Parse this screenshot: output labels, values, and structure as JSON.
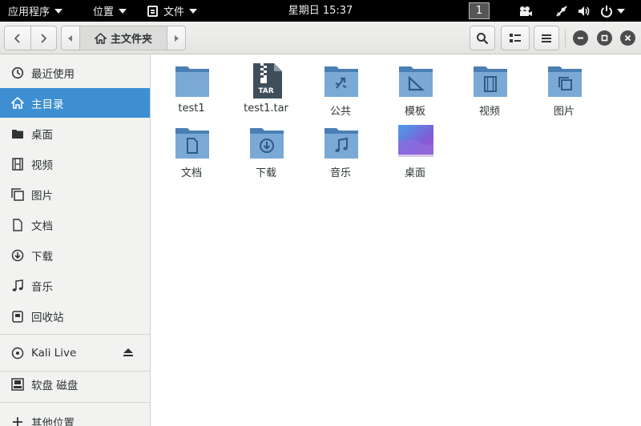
{
  "topbar": {
    "apps_label": "应用程序",
    "places_label": "位置",
    "files_label": "文件",
    "clock": "星期日 15:37",
    "workspace": "1"
  },
  "header": {
    "breadcrumb_current": "主文件夹"
  },
  "sidebar": {
    "items": [
      {
        "label": "最近使用",
        "icon": "clock-icon"
      },
      {
        "label": "主目录",
        "icon": "home-icon"
      },
      {
        "label": "桌面",
        "icon": "folder-icon"
      },
      {
        "label": "视频",
        "icon": "film-icon"
      },
      {
        "label": "图片",
        "icon": "picture-icon"
      },
      {
        "label": "文档",
        "icon": "document-icon"
      },
      {
        "label": "下载",
        "icon": "download-icon"
      },
      {
        "label": "音乐",
        "icon": "music-icon"
      },
      {
        "label": "回收站",
        "icon": "trash-icon"
      }
    ],
    "devices": [
      {
        "label": "Kali Live",
        "icon": "disc-icon"
      },
      {
        "label": "软盘 磁盘",
        "icon": "floppy-icon"
      }
    ],
    "other": {
      "label": "其他位置",
      "icon": "plus-icon"
    }
  },
  "files": [
    {
      "name": "test1",
      "icon": "folder-icon"
    },
    {
      "name": "test1.tar",
      "icon": "tar-archive-icon",
      "badge": "TAR"
    },
    {
      "name": "公共",
      "icon": "folder-public-icon"
    },
    {
      "name": "模板",
      "icon": "folder-templates-icon"
    },
    {
      "name": "视频",
      "icon": "folder-videos-icon"
    },
    {
      "name": "图片",
      "icon": "folder-pictures-icon"
    },
    {
      "name": "文档",
      "icon": "folder-documents-icon"
    },
    {
      "name": "下载",
      "icon": "folder-download-icon"
    },
    {
      "name": "音乐",
      "icon": "folder-music-icon"
    },
    {
      "name": "桌面",
      "icon": "folder-desktop-icon"
    }
  ],
  "colors": {
    "accent": "#3d8fd1",
    "folder": "#6b9fd0",
    "folder_dark": "#3f6f9f"
  }
}
